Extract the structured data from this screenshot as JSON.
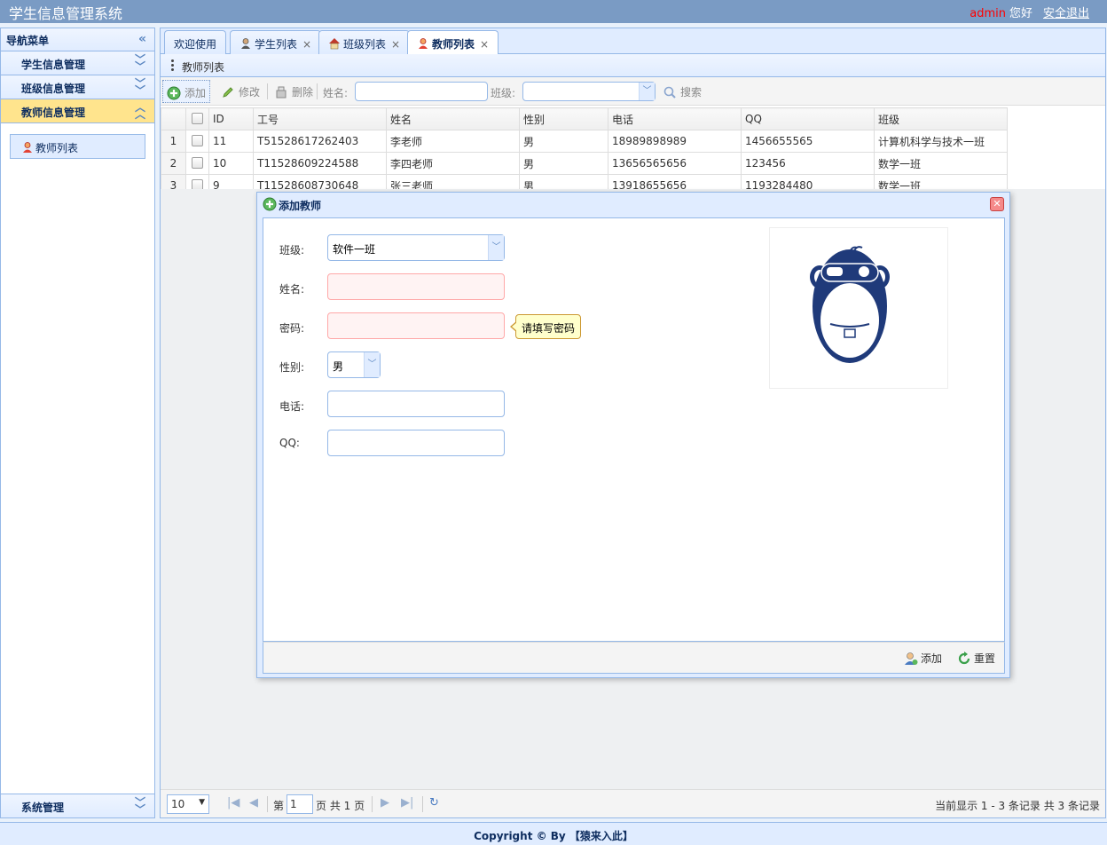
{
  "header": {
    "title": "学生信息管理系统",
    "user": "admin",
    "greeting": "您好",
    "logout": "安全退出"
  },
  "nav": {
    "title": "导航菜单",
    "groups": [
      {
        "label": "学生信息管理"
      },
      {
        "label": "班级信息管理"
      },
      {
        "label": "教师信息管理"
      }
    ],
    "active_item": "教师列表",
    "bottom_group": "系统管理"
  },
  "tabs": [
    {
      "label": "欢迎使用"
    },
    {
      "label": "学生列表"
    },
    {
      "label": "班级列表"
    },
    {
      "label": "教师列表"
    }
  ],
  "panel": {
    "title": "教师列表"
  },
  "toolbar": {
    "add": "添加",
    "edit": "修改",
    "delete": "删除",
    "name_label": "姓名:",
    "class_label": "班级:",
    "search": "搜索"
  },
  "table": {
    "columns": [
      "ID",
      "工号",
      "姓名",
      "性别",
      "电话",
      "QQ",
      "班级"
    ],
    "rows": [
      {
        "rn": "1",
        "id": "11",
        "no": "T51528617262403",
        "name": "李老师",
        "sex": "男",
        "phone": "18989898989",
        "qq": "1456655565",
        "class": "计算机科学与技术一班"
      },
      {
        "rn": "2",
        "id": "10",
        "no": "T11528609224588",
        "name": "李四老师",
        "sex": "男",
        "phone": "13656565656",
        "qq": "123456",
        "class": "数学一班"
      },
      {
        "rn": "3",
        "id": "9",
        "no": "T11528608730648",
        "name": "张三老师",
        "sex": "男",
        "phone": "13918655656",
        "qq": "1193284480",
        "class": "数学一班"
      }
    ]
  },
  "pager": {
    "page_size": "10",
    "page_prefix": "第",
    "page_value": "1",
    "page_suffix": "页 共 1 页",
    "info": "当前显示 1 - 3 条记录 共 3 条记录"
  },
  "dialog": {
    "title": "添加教师",
    "fields": {
      "class_label": "班级:",
      "class_value": "软件一班",
      "name_label": "姓名:",
      "password_label": "密码:",
      "password_tip": "请填写密码",
      "sex_label": "性别:",
      "sex_value": "男",
      "phone_label": "电话:",
      "qq_label": "QQ:"
    },
    "add_button": "添加",
    "reset_button": "重置"
  },
  "footer": {
    "text": "Copyright © By 【猿来入此】"
  },
  "colors": {
    "border": "#95b8e7",
    "active_group": "#ffe48d",
    "header_bg": "#7a9bc4",
    "user_name": "#ff0000"
  }
}
